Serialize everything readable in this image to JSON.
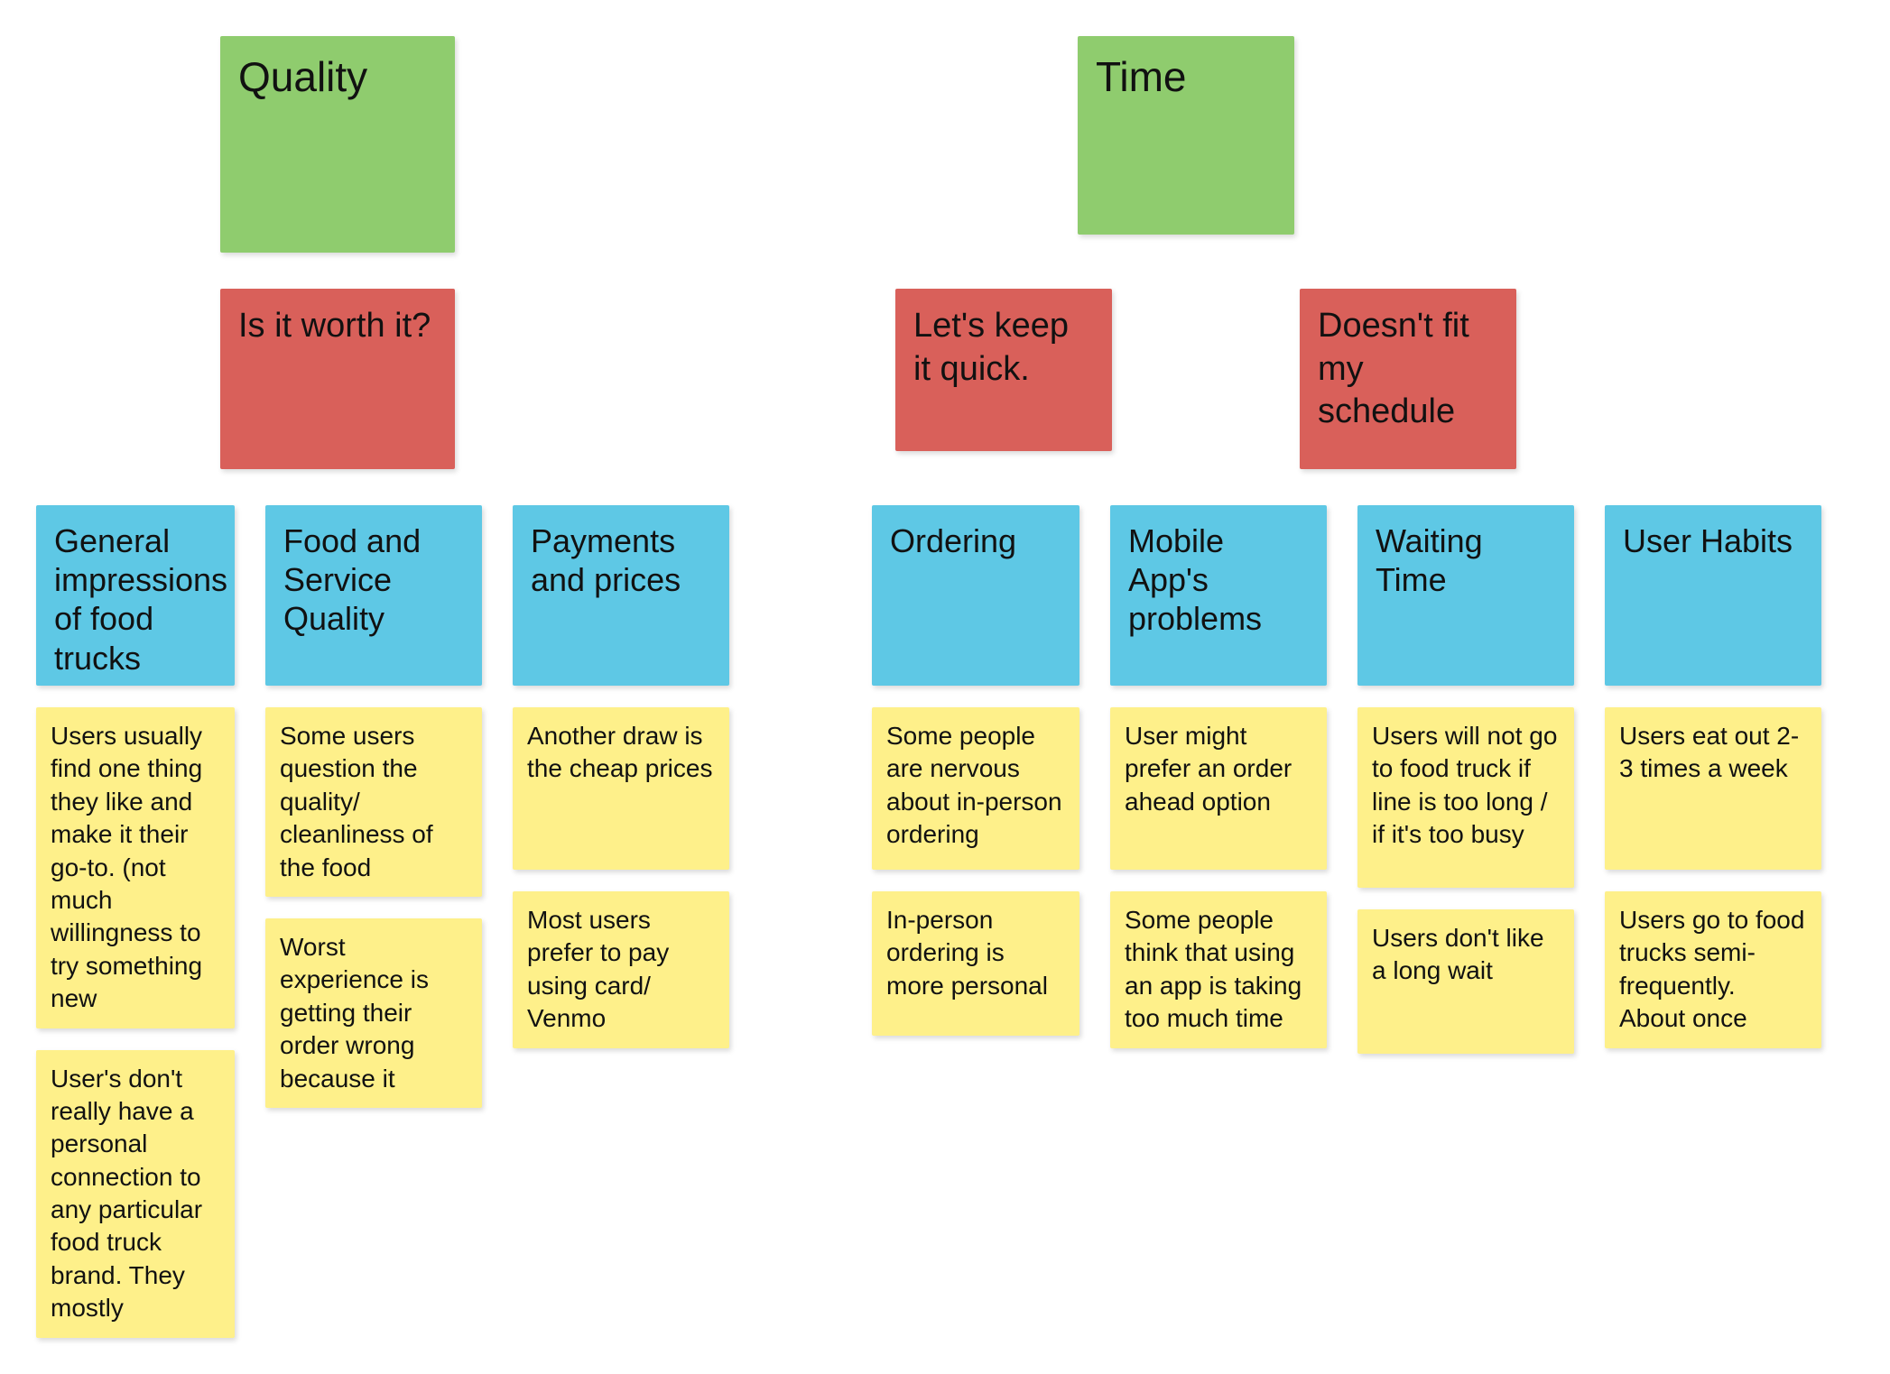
{
  "categories": [
    {
      "id": "quality",
      "label": "Quality"
    },
    {
      "id": "time",
      "label": "Time"
    }
  ],
  "subcategories": [
    {
      "id": "worth-it",
      "label": "Is it worth it?",
      "col": "quality"
    },
    {
      "id": "keep-quick",
      "label": "Let's keep it quick.",
      "col": "time-left"
    },
    {
      "id": "schedule",
      "label": "Doesn't fit my schedule",
      "col": "time-right"
    }
  ],
  "topics": [
    {
      "id": "general",
      "label": "General impressions of food trucks"
    },
    {
      "id": "food-service",
      "label": "Food and Service Quality"
    },
    {
      "id": "payments",
      "label": "Payments and prices"
    },
    {
      "id": "ordering",
      "label": "Ordering"
    },
    {
      "id": "mobile-app",
      "label": "Mobile App's problems"
    },
    {
      "id": "waiting-time",
      "label": "Waiting Time"
    },
    {
      "id": "user-habits",
      "label": "User Habits"
    }
  ],
  "notes": {
    "general": [
      "Users usually find one thing they like and make it their go-to. (not much willingness to try something new",
      "User's don't really have a personal connection to any particular food truck brand. They mostly"
    ],
    "food-service": [
      "Some users question the quality/ cleanliness of the food",
      "Worst experience is getting their order wrong because it"
    ],
    "payments": [
      "Another draw is the cheap prices",
      "Most users prefer to pay using card/ Venmo"
    ],
    "ordering": [
      "Some people are nervous about in-person ordering",
      "In-person ordering is more personal"
    ],
    "mobile-app": [
      "User might prefer an order ahead option",
      "Some people think that using an app is taking too much time"
    ],
    "waiting-time": [
      "Users will not go to food truck if line is too long / if it's too busy",
      "Users don't like a long wait"
    ],
    "user-habits": [
      "Users eat out 2-3 times a week",
      "Users go to food trucks semi-frequently. About once"
    ]
  }
}
